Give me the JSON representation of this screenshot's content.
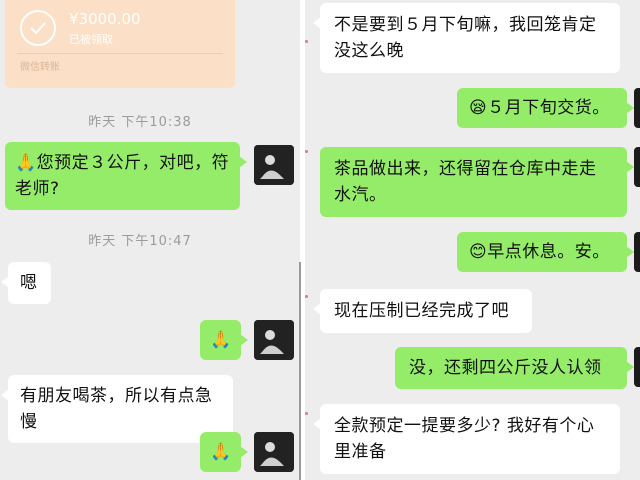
{
  "left": {
    "transfer": {
      "amount": "¥3000.00",
      "status": "已被领取",
      "footer": "微信转账"
    },
    "time1": "昨天 下午10:38",
    "msg1_icon": "🙏",
    "msg1_text": "您预定３公斤，对吧，符老师?",
    "time2": "昨天 下午10:47",
    "msg2": "嗯",
    "msg3": "🙏",
    "msg4": "有朋友喝茶，所以有点急慢",
    "msg5": "🙏"
  },
  "right": {
    "msg1": "不是要到５月下旬嘛，我回笼肯定没这么晚",
    "msg2_icon": "😪",
    "msg2_text": "５月下旬交货。",
    "msg3": "茶品做出来，还得留在仓库中走走水汽。",
    "msg4_icon": "😊",
    "msg4_text": "早点休息。安。",
    "msg5": "现在压制已经完成了吧",
    "msg6": "没，还剩四公斤没人认领",
    "msg7": "全款预定一提要多少? 我好有个心里准备"
  },
  "colors": {
    "sent_bubble": "#95ec69",
    "received_bubble": "#ffffff",
    "background": "#ededed",
    "transfer_card": "#fbdfc6"
  },
  "icons": [
    "check-circle-icon",
    "avatar"
  ]
}
